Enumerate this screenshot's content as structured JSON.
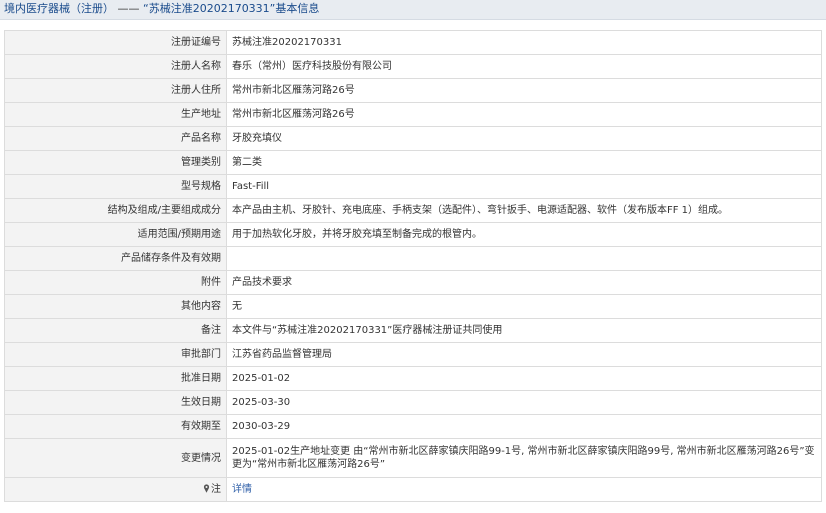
{
  "header": {
    "breadcrumb": "境内医疗器械（注册）",
    "separator": " —— ",
    "record_title": "“苏械注准20202170331”基本信息"
  },
  "rows": [
    {
      "label": "注册证编号",
      "value": "苏械注准20202170331"
    },
    {
      "label": "注册人名称",
      "value": "春乐（常州）医疗科技股份有限公司"
    },
    {
      "label": "注册人住所",
      "value": "常州市新北区雁荡河路26号"
    },
    {
      "label": "生产地址",
      "value": "常州市新北区雁荡河路26号"
    },
    {
      "label": "产品名称",
      "value": "牙胶充填仪"
    },
    {
      "label": "管理类别",
      "value": "第二类"
    },
    {
      "label": "型号规格",
      "value": "Fast-Fill"
    },
    {
      "label": "结构及组成/主要组成成分",
      "value": "本产品由主机、牙胶针、充电底座、手柄支架（选配件）、弯针扳手、电源适配器、软件（发布版本FF 1）组成。"
    },
    {
      "label": "适用范围/预期用途",
      "value": "用于加热软化牙胶，并将牙胶充填至制备完成的根管内。"
    },
    {
      "label": "产品储存条件及有效期",
      "value": ""
    },
    {
      "label": "附件",
      "value": "产品技术要求"
    },
    {
      "label": "其他内容",
      "value": "无"
    },
    {
      "label": "备注",
      "value": "本文件与“苏械注准20202170331”医疗器械注册证共同使用"
    },
    {
      "label": "审批部门",
      "value": "江苏省药品监督管理局"
    },
    {
      "label": "批准日期",
      "value": "2025-01-02"
    },
    {
      "label": "生效日期",
      "value": "2025-03-30"
    },
    {
      "label": "有效期至",
      "value": "2030-03-29"
    },
    {
      "label": "变更情况",
      "value": "2025-01-02生产地址变更 由“常州市新北区薛家镇庆阳路99-1号, 常州市新北区薛家镇庆阳路99号, 常州市新北区雁荡河路26号”变更为“常州市新北区雁荡河路26号”"
    }
  ],
  "note": {
    "label": "注",
    "link": "详情",
    "icon": "pin-icon"
  }
}
